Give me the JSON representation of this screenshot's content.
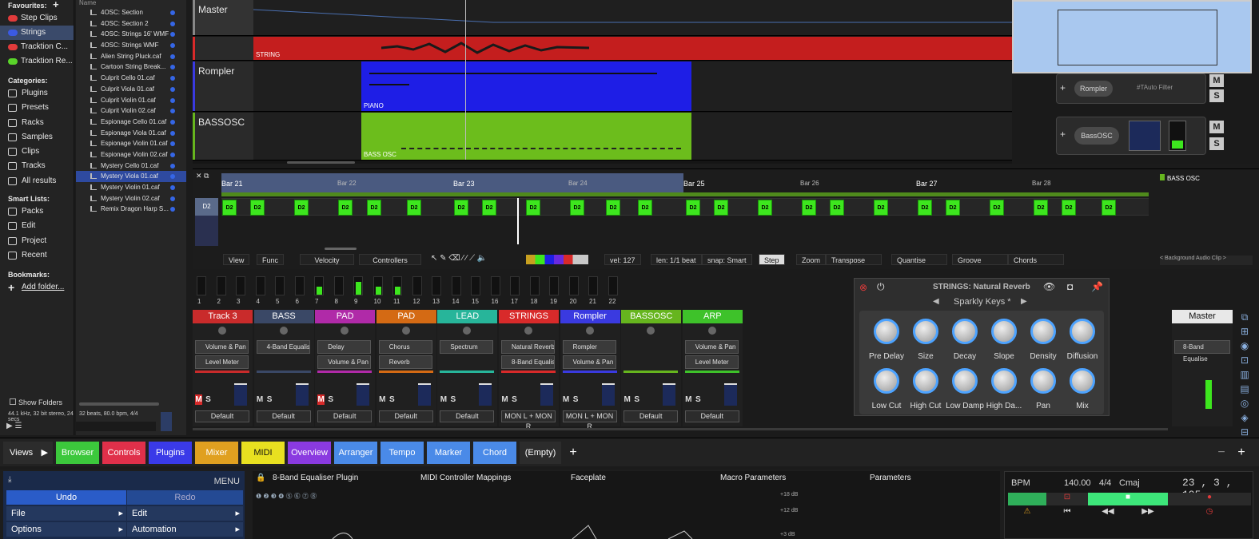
{
  "favourites": {
    "title": "Favourites:",
    "items": [
      {
        "label": "Step Clips",
        "color": "#e23b3b"
      },
      {
        "label": "Strings",
        "color": "#3b5ae2"
      },
      {
        "label": "Tracktion C...",
        "color": "#e23b3b"
      },
      {
        "label": "Tracktion Re...",
        "color": "#5ad42a"
      }
    ]
  },
  "categories": {
    "title": "Categories:",
    "items": [
      "Plugins",
      "Presets",
      "Racks",
      "Samples",
      "Clips",
      "Tracks",
      "All results"
    ]
  },
  "smart_lists": {
    "title": "Smart Lists:",
    "items": [
      "Packs",
      "Edit",
      "Project",
      "Recent"
    ]
  },
  "bookmarks": {
    "title": "Bookmarks:",
    "add": "Add folder..."
  },
  "files": {
    "header": "Name",
    "items": [
      "4OSC: Section",
      "4OSC: Section 2",
      "4OSC: Strings 16' WMF",
      "4OSC: Strings WMF",
      "Alien String Pluck.caf",
      "Cartoon String Break...",
      "Culprit Cello 01.caf",
      "Culprit Viola 01.caf",
      "Culprit Violin 01.caf",
      "Culprit Violin 02.caf",
      "Espionage Cello 01.caf",
      "Espionage Viola 01.caf",
      "Espionage Violin 01.caf",
      "Espionage Violin 02.caf",
      "Mystery Cello 01.caf",
      "Mystery Viola 01.caf",
      "Mystery Violin 01.caf",
      "Mystery Violin 02.caf",
      "Remix Dragon Harp S..."
    ],
    "selected": 15
  },
  "show_folders": "Show Folders",
  "file_info": "44.1 kHz, 32 bit stereo, 24 secs",
  "file_info2": "32 beats, 80.0 bpm, 4/4",
  "tracks": [
    {
      "name": "Master"
    },
    {
      "name": "",
      "clip": "STRING"
    },
    {
      "name": "Rompler",
      "clip": "PIANO"
    },
    {
      "name": "BASSOSC",
      "clip": "BASS OSC"
    }
  ],
  "racks": [
    {
      "label": "Rompler",
      "filter": "#TAuto Filter"
    },
    {
      "label": "BassOSC"
    }
  ],
  "m_label": "M",
  "s_label": "S",
  "pianoroll": {
    "bars": [
      "Bar 21",
      "Bar 22",
      "Bar 23",
      "Bar 24",
      "Bar 25",
      "Bar 26",
      "Bar 27",
      "Bar 28"
    ],
    "key": "D2",
    "note": "D2",
    "clip_name": "BASS OSC",
    "bg_clip": "< Background Audio Clip >",
    "toolbar": {
      "view": "View",
      "func": "Func",
      "velocity": "Velocity",
      "controllers": "Controllers",
      "vel": "vel: 127",
      "len": "len: 1/1 beat",
      "snap": "snap: Smart",
      "step": "Step",
      "zoom": "Zoom",
      "transpose": "Transpose",
      "quantise": "Quantise",
      "groove": "Groove",
      "chords": "Chords"
    }
  },
  "meters": [
    "1",
    "2",
    "3",
    "4",
    "5",
    "6",
    "7",
    "8",
    "9",
    "10",
    "11",
    "12",
    "13",
    "14",
    "15",
    "16",
    "17",
    "18",
    "19",
    "20",
    "21",
    "22"
  ],
  "mixer": [
    {
      "name": "Track 3",
      "color": "#c92b2b",
      "p1": "Volume & Pan Plugin",
      "p2": "Level Meter",
      "out": "Default"
    },
    {
      "name": "BASS",
      "color": "#3a4866",
      "p1": "4-Band Equaliser",
      "p2": "",
      "out": "Default"
    },
    {
      "name": "PAD",
      "color": "#b02aa8",
      "p1": "Delay",
      "p2": "Volume & Pan Plugin",
      "out": "Default"
    },
    {
      "name": "PAD",
      "color": "#d46a14",
      "p1": "Chorus",
      "p2": "Reverb",
      "out": "Default"
    },
    {
      "name": "LEAD",
      "color": "#27b59a",
      "p1": "Spectrum",
      "p2": "",
      "out": "Default"
    },
    {
      "name": "STRINGS",
      "color": "#d82a2a",
      "p1": "Natural Reverb",
      "p2": "8-Band Equaliser",
      "out": "MON L + MON R"
    },
    {
      "name": "Rompler",
      "color": "#3a3ae0",
      "p1": "Rompler",
      "p2": "Volume & Pan Plugin",
      "out": "MON L + MON R"
    },
    {
      "name": "BASSOSC",
      "color": "#66b51e",
      "p1": "",
      "p2": "",
      "out": "Default"
    },
    {
      "name": "ARP",
      "color": "#3ec22a",
      "p1": "Volume & Pan Plugin",
      "p2": "Level Meter",
      "out": "Default"
    }
  ],
  "master": {
    "name": "Master",
    "plugin": "8-Band Equalise"
  },
  "reverb": {
    "title": "STRINGS: Natural Reverb",
    "preset": "Sparkly Keys *",
    "knobs": [
      "Pre Delay",
      "Size",
      "Decay",
      "Slope",
      "Density",
      "Diffusion",
      "Low Cut",
      "High Cut",
      "Low Damp",
      "High Da...",
      "Pan",
      "Mix"
    ]
  },
  "views": {
    "label": "Views",
    "buttons": [
      {
        "label": "Browser",
        "color": "#3cc83c"
      },
      {
        "label": "Controls",
        "color": "#e0304a"
      },
      {
        "label": "Plugins",
        "color": "#3a3ae8"
      },
      {
        "label": "Mixer",
        "color": "#e0a020"
      },
      {
        "label": "MIDI",
        "color": "#e8e020"
      },
      {
        "label": "Overview",
        "color": "#8a3ae0"
      },
      {
        "label": "Arranger",
        "color": "#4a8ae8"
      },
      {
        "label": "Tempo",
        "color": "#4a8ae8"
      },
      {
        "label": "Marker",
        "color": "#4a8ae8"
      },
      {
        "label": "Chord",
        "color": "#4a8ae8"
      },
      {
        "label": "(Empty)",
        "color": "#2c2c2c"
      }
    ]
  },
  "bottom": {
    "menu": "MENU",
    "undo": "Undo",
    "redo": "Redo",
    "file": "File",
    "edit": "Edit",
    "options": "Options",
    "automation": "Automation",
    "tabs": [
      "8-Band Equaliser Plugin",
      "MIDI Controller Mappings",
      "Faceplate",
      "Macro Parameters",
      "Parameters"
    ],
    "db": [
      "+18 dB",
      "+12 dB",
      "+3 dB"
    ]
  },
  "transport": {
    "bpm_label": "BPM",
    "bpm": "140.00",
    "sig": "4/4",
    "key": "Cmaj",
    "pos": "23 , 3 , 195"
  }
}
